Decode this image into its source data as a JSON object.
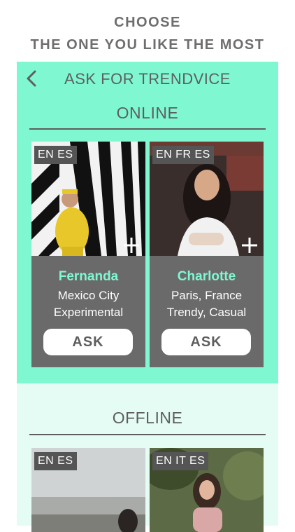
{
  "header": {
    "line1": "CHOOSE",
    "line2": "THE ONE YOU LIKE THE MOST"
  },
  "app": {
    "title": "ASK FOR TRENDVICE",
    "back_icon": "chevron-left-icon"
  },
  "online": {
    "title": "ONLINE",
    "cards": [
      {
        "languages": "EN ES",
        "name": "Fernanda",
        "location": "Mexico City",
        "style": "Experimental",
        "ask_label": "ASK",
        "plus_icon": "plus-icon"
      },
      {
        "languages": "EN FR ES",
        "name": "Charlotte",
        "location": "Paris, France",
        "style": "Trendy, Casual",
        "ask_label": "ASK",
        "plus_icon": "plus-icon"
      }
    ]
  },
  "offline": {
    "title": "OFFLINE",
    "cards": [
      {
        "languages": "EN ES"
      },
      {
        "languages": "EN IT ES"
      }
    ]
  },
  "colors": {
    "accent": "#7ff8d2",
    "card_bg": "#6a6a6a",
    "text_dark": "#5e5e5e",
    "offline_bg": "#e4fcf3"
  }
}
